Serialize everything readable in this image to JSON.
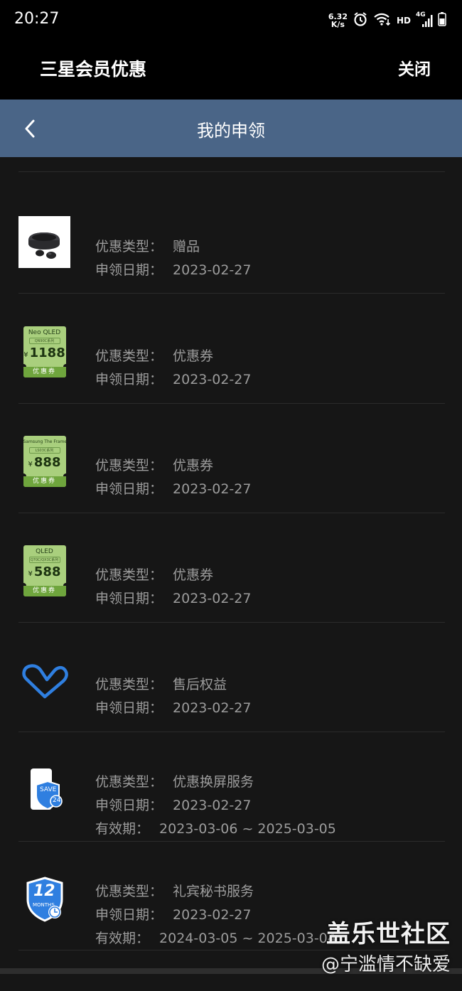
{
  "status": {
    "time": "20:27",
    "speed_value": "6.32",
    "speed_unit": "K/s",
    "hd": "HD",
    "network": "4G"
  },
  "app": {
    "title": "三星会员优惠",
    "close_label": "关闭"
  },
  "nav": {
    "title": "我的申领"
  },
  "labels": {
    "type": "优惠类型：",
    "date": "申领日期：",
    "validity": "有效期："
  },
  "items": [
    {
      "icon": "earbuds-image",
      "type": "赠品",
      "date": "2023-02-27"
    },
    {
      "icon": "coupon-image",
      "type": "优惠券",
      "date": "2023-02-27",
      "coupon": {
        "name": "Neo QLED",
        "series": "QN90C系列",
        "amount": "1188",
        "footer": "优惠券"
      }
    },
    {
      "icon": "coupon-image",
      "type": "优惠券",
      "date": "2023-02-27",
      "coupon": {
        "name": "Samsung The Frame",
        "series": "LS03C系列",
        "amount": "888",
        "footer": "优惠券"
      }
    },
    {
      "icon": "coupon-image",
      "type": "优惠券",
      "date": "2023-02-27",
      "coupon": {
        "name": "QLED",
        "series": "Q70C/QX3C系列",
        "amount": "588",
        "footer": "优惠券"
      }
    },
    {
      "icon": "heart-icon",
      "type": "售后权益",
      "date": "2023-02-27"
    },
    {
      "icon": "screen-save-icon",
      "type": "优惠换屏服务",
      "date": "2023-02-27",
      "validity": "2023-03-06 ~ 2025-03-05",
      "badge": {
        "text": "SAVE",
        "number": "24"
      }
    },
    {
      "icon": "concierge-12-months-icon",
      "type": "礼宾秘书服务",
      "date": "2023-02-27",
      "validity": "2024-03-05 ~ 2025-03-04",
      "badge": {
        "number": "12",
        "text": "MONTHS"
      }
    }
  ],
  "watermark": {
    "line1": "盖乐世社区",
    "line2": "@宁滥情不缺爱"
  },
  "colors": {
    "nav_bg": "#4a6587",
    "coupon_bg": "#a9cf7d",
    "coupon_footer": "#6fa53d",
    "icon_blue": "#2f7fe0"
  }
}
